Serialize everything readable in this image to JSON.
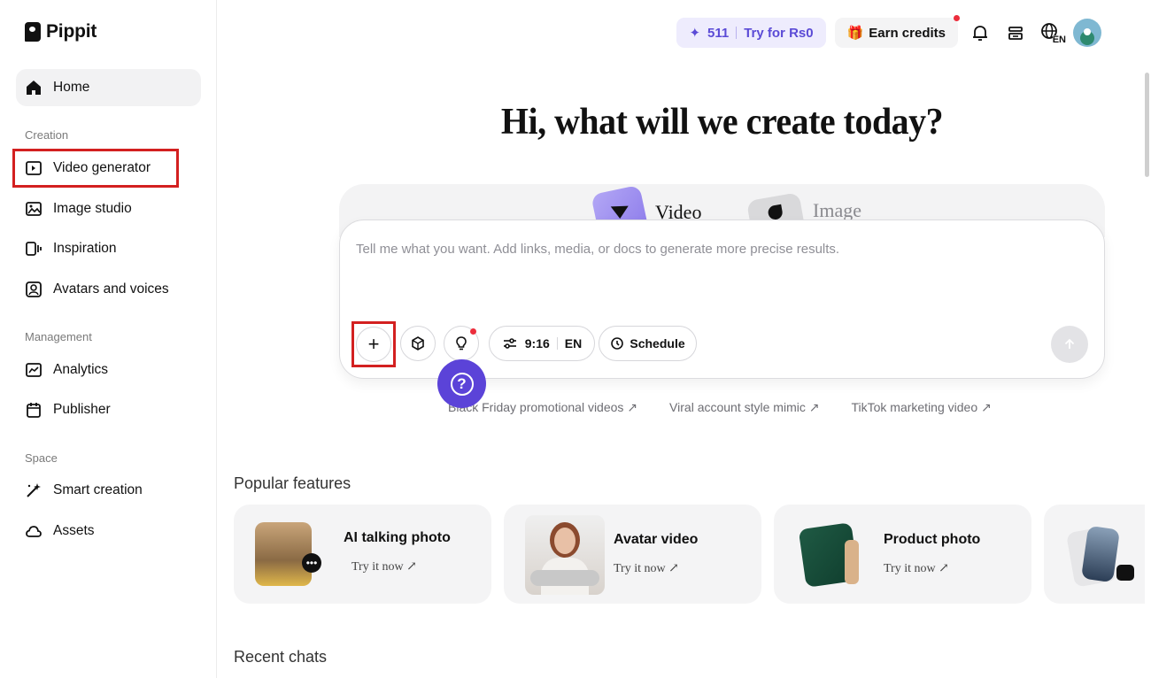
{
  "app": {
    "name": "Pippit"
  },
  "sidebar": {
    "home": "Home",
    "sections": {
      "creation": "Creation",
      "management": "Management",
      "space": "Space"
    },
    "creation_items": [
      "Video generator",
      "Image studio",
      "Inspiration",
      "Avatars and voices"
    ],
    "management_items": [
      "Analytics",
      "Publisher"
    ],
    "space_items": [
      "Smart creation",
      "Assets"
    ]
  },
  "topbar": {
    "credits": "511",
    "try_label": "Try for Rs0",
    "earn_label": "Earn credits",
    "language": "EN"
  },
  "hero": {
    "title": "Hi, what will we create today?",
    "tabs": [
      "Video",
      "Image"
    ],
    "active_tab": "Video",
    "placeholder": "Tell me what you want. Add links, media, or docs to generate more precise results.",
    "ratio_label": "9:16",
    "language_label": "EN",
    "schedule_label": "Schedule",
    "help_icon": "?",
    "add_icon": "+"
  },
  "suggestions": [
    "Black Friday promotional videos ↗",
    "Viral account style mimic ↗",
    "TikTok marketing video ↗"
  ],
  "popular": {
    "title": "Popular features",
    "cards": [
      {
        "title": "AI talking photo",
        "link": "Try it now ↗"
      },
      {
        "title": "Avatar video",
        "link": "Try it now ↗"
      },
      {
        "title": "Product photo",
        "link": "Try it now ↗"
      }
    ]
  },
  "recent": {
    "title": "Recent chats"
  },
  "colors": {
    "accent": "#5b43d8",
    "highlight": "#d32020",
    "credits_text": "#5b4bd6"
  }
}
